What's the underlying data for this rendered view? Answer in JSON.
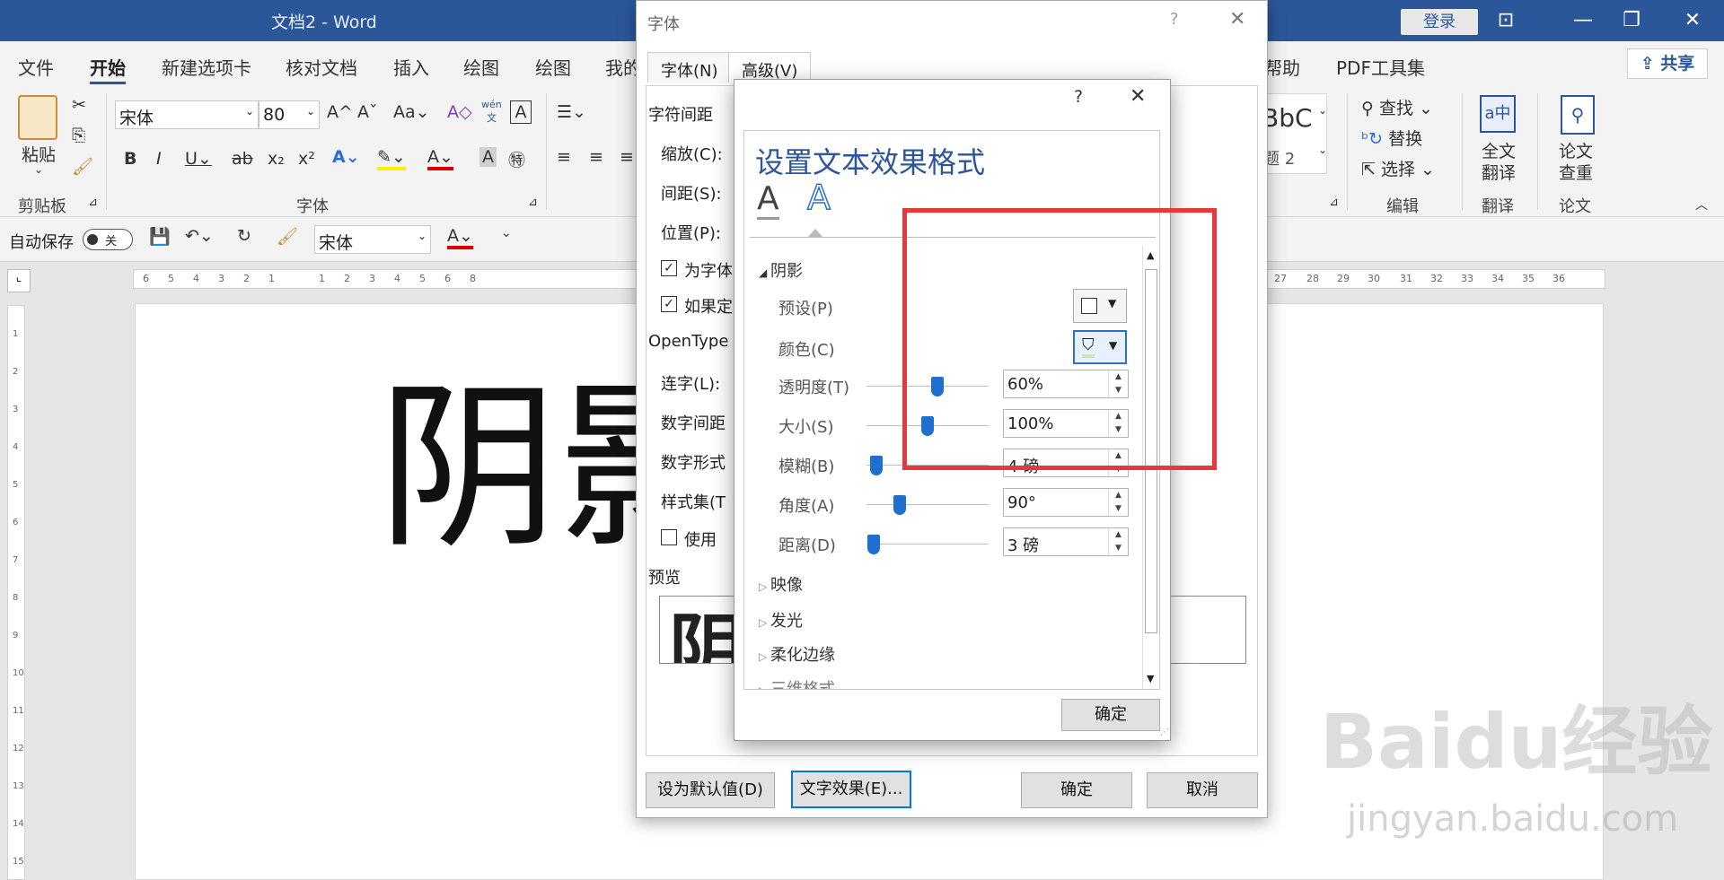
{
  "window": {
    "title": "文档2  -  Word",
    "login_label": "登录",
    "share_label": "共享"
  },
  "tabs": [
    "文件",
    "开始",
    "新建选项卡",
    "核对文档",
    "插入",
    "绘图",
    "绘图",
    "我的",
    "帮助",
    "PDF工具集"
  ],
  "ribbon": {
    "clipboard": {
      "paste_label": "粘贴",
      "group_label": "剪贴板"
    },
    "font": {
      "font_name": "宋体",
      "font_size": "80",
      "group_label": "字体",
      "aa_label": "Aa",
      "wen_label": "wén",
      "wen_sub": "文"
    },
    "styles_preview": "BbC",
    "styles_sub": "题 2",
    "editing": {
      "find_label": "查找",
      "replace_label": "替换",
      "select_label": "选择",
      "group_label": "编辑"
    },
    "translate": {
      "full_label": "全文",
      "full_label2": "翻译",
      "group_label": "翻译"
    },
    "paper": {
      "label": "论文",
      "label2": "查重",
      "group_label": "论文"
    }
  },
  "qat": {
    "autosave_label": "自动保存",
    "autosave_state": "关",
    "font_name": "宋体"
  },
  "ruler": [
    "6",
    "5",
    "4",
    "3",
    "2",
    "1",
    "",
    "1",
    "2",
    "3",
    "4",
    "5",
    "6",
    "8",
    "27",
    "28",
    "29",
    "30",
    "31",
    "32",
    "33",
    "34",
    "35",
    "36"
  ],
  "vruler": [
    "1",
    "2",
    "3",
    "4",
    "5",
    "6",
    "7",
    "8",
    "9",
    "10",
    "11",
    "12",
    "13",
    "14",
    "15"
  ],
  "document": {
    "big_text": "阴影"
  },
  "font_dialog": {
    "title": "字体",
    "help": "?",
    "tab_font": "字体(N)",
    "tab_advanced": "高级(V)",
    "section_spacing": "字符间距",
    "scale_label": "缩放(C):",
    "spacing_label": "间距(S):",
    "position_label": "位置(P):",
    "check1_label": "为字体",
    "check2_label": "如果定",
    "opentype_label": "OpenType",
    "ligature_label": "连字(L):",
    "num_spacing_label": "数字间距",
    "num_form_label": "数字形式",
    "style_set_label": "样式集(T",
    "use_label": "使用",
    "preview_label": "预览",
    "default_button": "设为默认值(D)",
    "effects_button": "文字效果(E)...",
    "ok_button": "确定",
    "cancel_button": "取消"
  },
  "effect_dialog": {
    "help": "?",
    "title": "设置文本效果格式",
    "shadow_section": "阴影",
    "preset_label": "预设(P)",
    "color_label": "颜色(C)",
    "rows": [
      {
        "label": "透明度(T)",
        "value": "60%",
        "pos": 0.58
      },
      {
        "label": "大小(S)",
        "value": "100%",
        "pos": 0.5
      },
      {
        "label": "模糊(B)",
        "value": "4 磅",
        "pos": 0.08
      },
      {
        "label": "角度(A)",
        "value": "90°",
        "pos": 0.27
      },
      {
        "label": "距离(D)",
        "value": "3 磅",
        "pos": 0.06
      }
    ],
    "reflection_section": "映像",
    "glow_section": "发光",
    "soft_edge_section": "柔化边缘",
    "three_d_section": "三维格式",
    "ok_button": "确定"
  },
  "watermark": {
    "brand": "Baidu经验",
    "url": "jingyan.baidu.com"
  }
}
